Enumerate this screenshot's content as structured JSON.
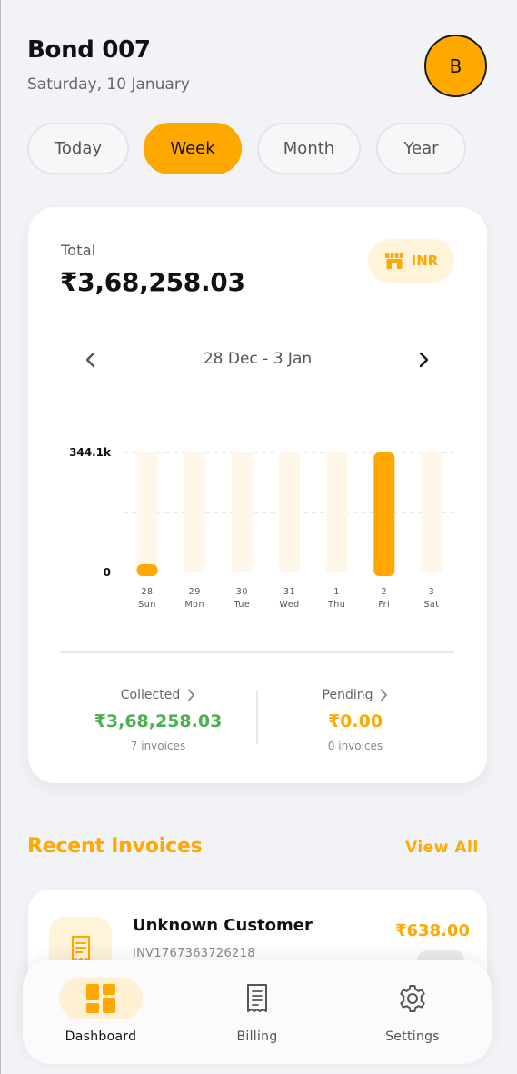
{
  "header": {
    "title": "Bond 007",
    "date": "Saturday, 10 January",
    "avatar_initial": "B"
  },
  "periods": [
    {
      "label": "Today",
      "active": false
    },
    {
      "label": "Week",
      "active": true
    },
    {
      "label": "Month",
      "active": false
    },
    {
      "label": "Year",
      "active": false
    }
  ],
  "summary": {
    "total_label": "Total",
    "total_value": "₹3,68,258.03",
    "currency": "INR",
    "range": "28 Dec - 3 Jan",
    "collected": {
      "label": "Collected",
      "value": "₹3,68,258.03",
      "sub": "7 invoices",
      "color": "#4caf50"
    },
    "pending": {
      "label": "Pending",
      "value": "₹0.00",
      "sub": "0 invoices",
      "color": "#ffa800"
    }
  },
  "chart_data": {
    "type": "bar",
    "x": [
      "28",
      "29",
      "30",
      "31",
      "1",
      "2",
      "3"
    ],
    "day_names": [
      "Sun",
      "Mon",
      "Tue",
      "Wed",
      "Thu",
      "Fri",
      "Sat"
    ],
    "values": [
      4500,
      0,
      0,
      0,
      0,
      344100,
      0
    ],
    "ytick_labels": [
      "344.1k",
      "0"
    ],
    "ylim": [
      0,
      344100
    ],
    "grid": true,
    "bar_color": "#ffa800",
    "track_color": "#fff8ea"
  },
  "recent": {
    "title": "Recent Invoices",
    "view_all": "View All",
    "items": [
      {
        "customer": "Unknown Customer",
        "invoice_id": "INV1767363726218",
        "amount": "₹638.00"
      }
    ]
  },
  "bottom_nav": [
    {
      "label": "Dashboard",
      "icon": "dashboard-icon",
      "active": true
    },
    {
      "label": "Billing",
      "icon": "receipt-icon",
      "active": false
    },
    {
      "label": "Settings",
      "icon": "gear-icon",
      "active": false
    }
  ],
  "colors": {
    "accent": "#ffa800",
    "success": "#4caf50"
  }
}
